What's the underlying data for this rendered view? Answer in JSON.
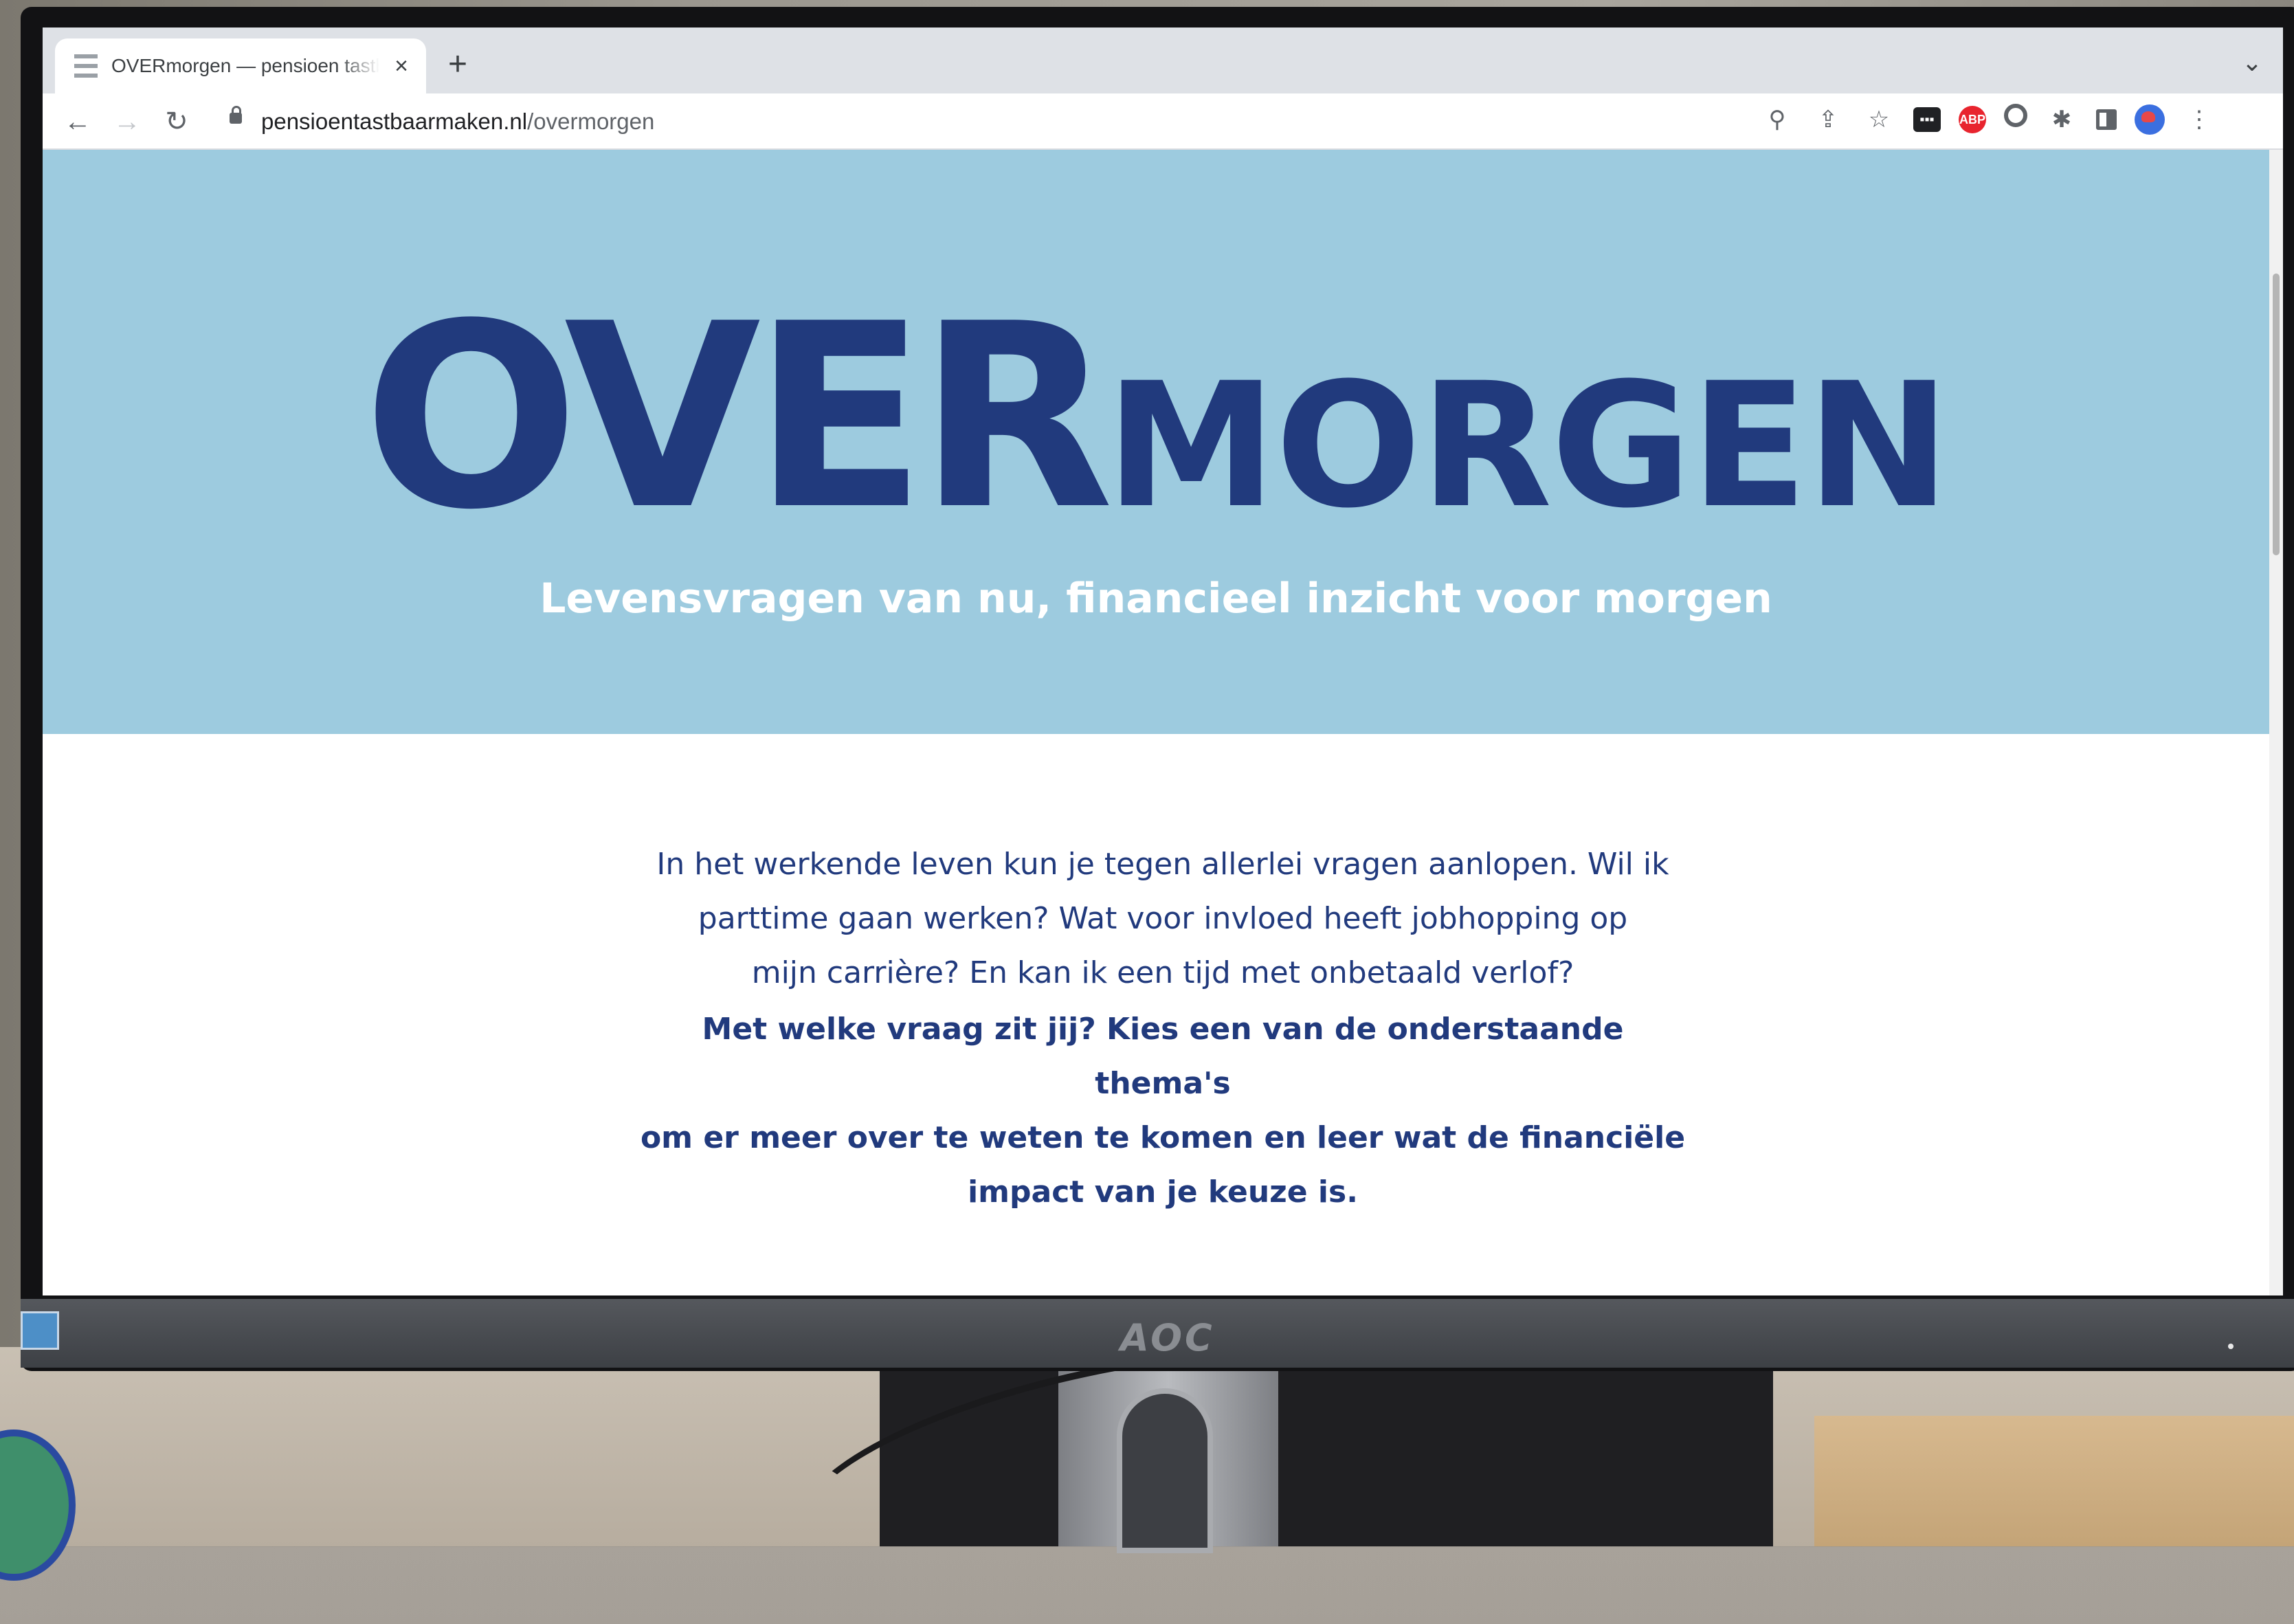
{
  "browser": {
    "tab": {
      "title": "OVERmorgen — pensioen tastbaarmaken",
      "close_icon": "×"
    },
    "new_tab_icon": "+",
    "tab_menu_icon": "⌄",
    "nav": {
      "back": "←",
      "forward": "→",
      "reload": "↻"
    },
    "address": {
      "host": "pensioentastbaarmaken.nl",
      "path": "/overmorgen"
    },
    "toolbar_icons": {
      "zoom": "⚲",
      "share": "⇪",
      "bookmark": "☆",
      "ext_dark": "▪▪▪",
      "abp": "ABP",
      "puzzle": "✱",
      "menu": "⋮"
    }
  },
  "hero": {
    "logo_big": "OVER",
    "logo_small": "MORGEN",
    "tagline": "Levensvragen van nu, financieel inzicht voor morgen",
    "background": "#9dcbdf",
    "text_color": "#213a7d"
  },
  "content": {
    "intro_lines": [
      "In het werkende leven kun je tegen allerlei vragen aanlopen. Wil ik",
      "parttime gaan werken? Wat voor invloed heeft jobhopping op",
      "mijn carrière? En kan ik een tijd met onbetaald verlof?"
    ],
    "cta_lines": [
      "Met welke vraag zit jij? Kies een van de onderstaande thema's",
      "om er meer over te weten te komen en leer wat de financiële",
      "impact van je keuze is."
    ]
  },
  "monitor": {
    "brand": "AOC"
  }
}
